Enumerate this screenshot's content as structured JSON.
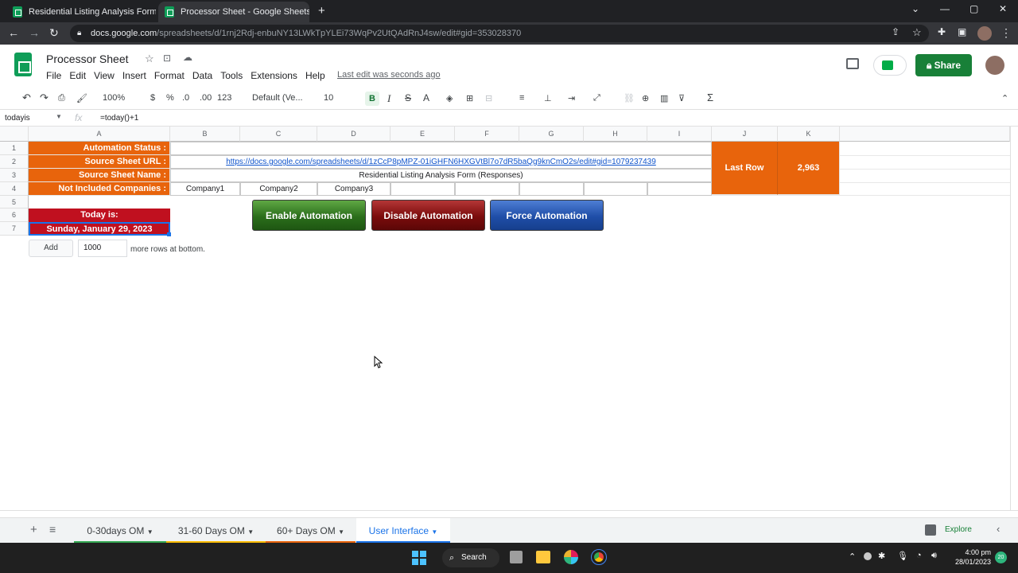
{
  "browser": {
    "tabs": [
      {
        "title": "Residential Listing Analysis Form"
      },
      {
        "title": "Processor Sheet - Google Sheets"
      }
    ],
    "url_domain": "docs.google.com",
    "url_path": "/spreadsheets/d/1rnj2Rdj-enbuNY13LWkTpYLEi73WqPv2UtQAdRnJ4sw/edit#gid=353028370"
  },
  "doc": {
    "title": "Processor Sheet",
    "menu": [
      "File",
      "Edit",
      "View",
      "Insert",
      "Format",
      "Data",
      "Tools",
      "Extensions",
      "Help"
    ],
    "last_edit": "Last edit was seconds ago",
    "share": "Share"
  },
  "toolbar": {
    "zoom": "100%",
    "currency": "$",
    "percent": "%",
    "dec_less": ".0",
    "dec_more": ".00",
    "format_more": "123",
    "font": "Default (Ve...",
    "font_size": "10",
    "bold": "B",
    "italic": "I",
    "strike": "S",
    "text_color": "A"
  },
  "formula_bar": {
    "name_box": "todayis",
    "fx": "fx",
    "formula": "=today()+1"
  },
  "columns": [
    "A",
    "B",
    "C",
    "D",
    "E",
    "F",
    "G",
    "H",
    "I",
    "J",
    "K"
  ],
  "rows": [
    "1",
    "2",
    "3",
    "4",
    "5",
    "6",
    "7"
  ],
  "cells": {
    "a1": "Automation Status :",
    "a2": "Source Sheet URL :",
    "a3": "Source Sheet Name :",
    "a4": "Not Included Companies :",
    "b2": "https://docs.google.com/spreadsheets/d/1zCcP8pMPZ-01iGHFN6HXGVtBl7o7dR5baQg9knCmO2s/edit#gid=1079237439",
    "b3": "Residential Listing Analysis Form (Responses)",
    "b4": "Company1",
    "c4": "Company2",
    "d4": "Company3",
    "j1": "Last Row",
    "k1": "2,963",
    "a6": "Today is:",
    "a7": "Sunday, January 29, 2023"
  },
  "buttons": {
    "enable": "Enable Automation",
    "disable": "Disable Automation",
    "force": "Force Automation"
  },
  "add_rows": {
    "button": "Add",
    "value": "1000",
    "suffix": "more rows at bottom."
  },
  "sheet_tabs": [
    {
      "label": "0-30days OM",
      "color": "#34a853"
    },
    {
      "label": "31-60 Days OM",
      "color": "#fbbc04"
    },
    {
      "label": "60+ Days OM",
      "color": "#e8640c"
    },
    {
      "label": "User Interface",
      "color": "#1a73e8"
    }
  ],
  "explore": "Explore",
  "taskbar": {
    "search": "Search",
    "time": "4:00 pm",
    "date": "28/01/2023",
    "badge": "20"
  }
}
